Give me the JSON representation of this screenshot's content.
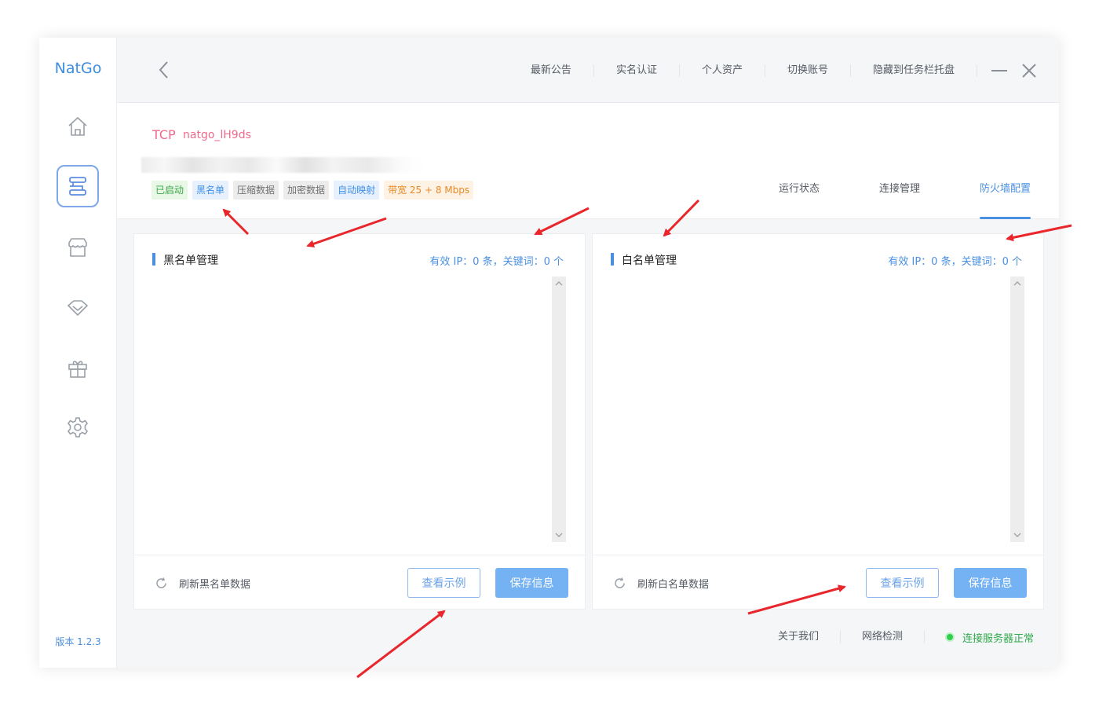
{
  "app": {
    "logo": "NatGo",
    "version": "版本 1.2.3"
  },
  "sidebar": {
    "items": [
      {
        "name": "home-icon",
        "active": false
      },
      {
        "name": "tunnel-icon",
        "active": true
      },
      {
        "name": "store-icon",
        "active": false
      },
      {
        "name": "diamond-icon",
        "active": false
      },
      {
        "name": "gift-icon",
        "active": false
      },
      {
        "name": "settings-icon",
        "active": false
      }
    ]
  },
  "topbar": {
    "links": [
      "最新公告",
      "实名认证",
      "个人资产",
      "切换账号",
      "隐藏到任务栏托盘"
    ],
    "back_icon": "chevron-left-icon",
    "minimize_icon": "minimize-icon",
    "close_icon": "close-icon"
  },
  "tunnel": {
    "protocol": "TCP",
    "name": "natgo_lH9ds",
    "tags": [
      "已启动",
      "黑名单",
      "压缩数据",
      "加密数据",
      "自动映射",
      "带宽 25 + 8 Mbps"
    ],
    "tag_colors": {
      "green": "#39a845",
      "blue": "#3f8fe6",
      "gray": "#707070",
      "orange": "#ea8a26"
    }
  },
  "tabs": {
    "items": [
      "运行状态",
      "连接管理",
      "防火墙配置"
    ],
    "active": "防火墙配置"
  },
  "blacklist": {
    "title": "黑名单管理",
    "stats": "有效 IP：0 条，关键词：0 个",
    "content": "",
    "refresh_label": "刷新黑名单数据",
    "example_label": "查看示例",
    "save_label": "保存信息"
  },
  "whitelist": {
    "title": "白名单管理",
    "stats": "有效 IP：0 条，关键词：0 个",
    "content": "",
    "refresh_label": "刷新白名单数据",
    "example_label": "查看示例",
    "save_label": "保存信息"
  },
  "footer": {
    "about": "关于我们",
    "network_check": "网络检测",
    "status": "连接服务器正常",
    "status_color": "#2faa4c"
  },
  "colors": {
    "accent": "#4a90e2",
    "protocol": "#f06a8d",
    "annotation_arrow": "#e8262b"
  }
}
